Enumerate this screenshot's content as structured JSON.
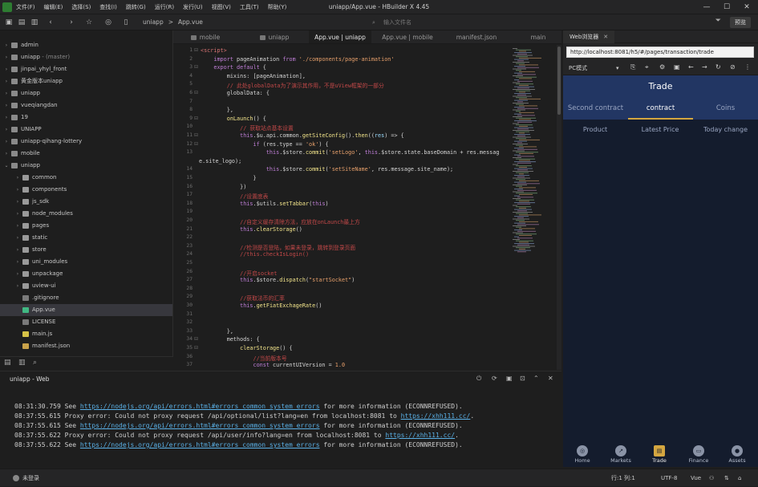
{
  "window": {
    "title": "uniapp/App.vue - HBuilder X 4.45",
    "menu": [
      "文件(F)",
      "编辑(E)",
      "选择(S)",
      "查找(I)",
      "跳转(G)",
      "运行(R)",
      "发行(U)",
      "视图(V)",
      "工具(T)",
      "帮助(Y)"
    ],
    "controls": {
      "minimize": "—",
      "maximize": "☐",
      "close": "✕"
    }
  },
  "toolbar": {
    "breadcrumb": [
      "uniapp",
      ">",
      "App.vue"
    ],
    "file_input_placeholder": "输入文件名",
    "preview_label": "预览"
  },
  "sidebar": {
    "items": [
      {
        "name": "admin",
        "level": 0,
        "type": "project",
        "open": false
      },
      {
        "name": "uniapp",
        "sub": " - (master)",
        "level": 0,
        "type": "project",
        "open": false
      },
      {
        "name": "jinpai_yhyl_front",
        "level": 0,
        "type": "project",
        "open": false
      },
      {
        "name": "黄金版本uniapp",
        "level": 0,
        "type": "project",
        "open": false
      },
      {
        "name": "uniapp",
        "level": 0,
        "type": "project",
        "open": false
      },
      {
        "name": "vueqiangdan",
        "level": 0,
        "type": "project",
        "open": false
      },
      {
        "name": "19",
        "level": 0,
        "type": "project",
        "open": false
      },
      {
        "name": "UNIAPP",
        "level": 0,
        "type": "project",
        "open": false
      },
      {
        "name": "uniapp-qihang-lottery",
        "level": 0,
        "type": "project",
        "open": false
      },
      {
        "name": "mobile",
        "level": 0,
        "type": "project",
        "open": false
      },
      {
        "name": "uniapp",
        "level": 0,
        "type": "project",
        "open": true
      },
      {
        "name": "common",
        "level": 1,
        "type": "folder",
        "open": false
      },
      {
        "name": "components",
        "level": 1,
        "type": "folder",
        "open": false
      },
      {
        "name": "js_sdk",
        "level": 1,
        "type": "folder",
        "open": false
      },
      {
        "name": "node_modules",
        "level": 1,
        "type": "folder",
        "open": false
      },
      {
        "name": "pages",
        "level": 1,
        "type": "folder",
        "open": false
      },
      {
        "name": "static",
        "level": 1,
        "type": "folder",
        "open": false
      },
      {
        "name": "store",
        "level": 1,
        "type": "folder",
        "open": false
      },
      {
        "name": "uni_modules",
        "level": 1,
        "type": "folder",
        "open": false
      },
      {
        "name": "unpackage",
        "level": 1,
        "type": "folder",
        "open": false
      },
      {
        "name": "uview-ui",
        "level": 1,
        "type": "folder",
        "open": false
      },
      {
        "name": ".gitignore",
        "level": 1,
        "type": "file"
      },
      {
        "name": "App.vue",
        "level": 1,
        "type": "vue",
        "selected": true
      },
      {
        "name": "LICENSE",
        "level": 1,
        "type": "file"
      },
      {
        "name": "main.js",
        "level": 1,
        "type": "js"
      },
      {
        "name": "manifest.json",
        "level": 1,
        "type": "json"
      }
    ]
  },
  "editor_tabs": [
    "mobile",
    "uniapp",
    "App.vue | uniapp",
    "App.vue | mobile",
    "manifest.json",
    "main"
  ],
  "code_lines": [
    {
      "n": "1",
      "f": "⊟",
      "segs": [
        [
          "tag",
          "<script>"
        ]
      ]
    },
    {
      "n": "2",
      "f": "",
      "segs": [
        [
          "pn",
          "    "
        ],
        [
          "kw",
          "import"
        ],
        [
          "pn",
          " pageAnimation "
        ],
        [
          "kw",
          "from"
        ],
        [
          "pn",
          " "
        ],
        [
          "str",
          "'./components/page-animation'"
        ]
      ]
    },
    {
      "n": "3",
      "f": "⊟",
      "segs": [
        [
          "pn",
          "    "
        ],
        [
          "kw",
          "export default"
        ],
        [
          "pn",
          " {"
        ]
      ]
    },
    {
      "n": "4",
      "f": "",
      "segs": [
        [
          "pn",
          "        mixins: [pageAnimation],"
        ]
      ]
    },
    {
      "n": "5",
      "f": "",
      "segs": [
        [
          "cm",
          "        // 此处globalData为了演示其作用，不是uView框架的一部分"
        ]
      ]
    },
    {
      "n": "6",
      "f": "⊟",
      "segs": [
        [
          "pn",
          "        globalData: {"
        ]
      ]
    },
    {
      "n": "7",
      "f": "",
      "segs": [
        [
          "pn",
          ""
        ]
      ]
    },
    {
      "n": "8",
      "f": "",
      "segs": [
        [
          "pn",
          "        },"
        ]
      ]
    },
    {
      "n": "9",
      "f": "⊟",
      "segs": [
        [
          "pn",
          "        "
        ],
        [
          "fn",
          "onLaunch"
        ],
        [
          "pn",
          "() {"
        ]
      ]
    },
    {
      "n": "10",
      "f": "",
      "segs": [
        [
          "cm",
          "            // 获取站点基本设置"
        ]
      ]
    },
    {
      "n": "11",
      "f": "⊟",
      "segs": [
        [
          "pn",
          "            "
        ],
        [
          "kw",
          "this"
        ],
        [
          "pn",
          ".$u.api.common."
        ],
        [
          "fn",
          "getSiteConfig"
        ],
        [
          "pn",
          "()."
        ],
        [
          "fn",
          "then"
        ],
        [
          "pn",
          "(("
        ],
        [
          "var",
          "res"
        ],
        [
          "pn",
          ") => {"
        ]
      ]
    },
    {
      "n": "12",
      "f": "⊟",
      "segs": [
        [
          "pn",
          "                "
        ],
        [
          "kw",
          "if"
        ],
        [
          "pn",
          " (res.type == "
        ],
        [
          "str",
          "'ok'"
        ],
        [
          "pn",
          ") {"
        ]
      ]
    },
    {
      "n": "13",
      "f": "",
      "segs": [
        [
          "pn",
          "                    "
        ],
        [
          "kw",
          "this"
        ],
        [
          "pn",
          ".$store."
        ],
        [
          "fn",
          "commit"
        ],
        [
          "pn",
          "("
        ],
        [
          "str",
          "'setLogo'"
        ],
        [
          "pn",
          ", "
        ],
        [
          "kw",
          "this"
        ],
        [
          "pn",
          ".$store.state.baseDomain + res.messag"
        ]
      ]
    },
    {
      "n": "",
      "f": "",
      "segs": [
        [
          "pn",
          "e.site_logo);"
        ]
      ],
      "indent": false
    },
    {
      "n": "14",
      "f": "",
      "segs": [
        [
          "pn",
          "                    "
        ],
        [
          "kw",
          "this"
        ],
        [
          "pn",
          ".$store."
        ],
        [
          "fn",
          "commit"
        ],
        [
          "pn",
          "("
        ],
        [
          "str",
          "'setSiteName'"
        ],
        [
          "pn",
          ", res.message.site_name);"
        ]
      ]
    },
    {
      "n": "15",
      "f": "",
      "segs": [
        [
          "pn",
          "                }"
        ]
      ]
    },
    {
      "n": "16",
      "f": "",
      "segs": [
        [
          "pn",
          "            })"
        ]
      ]
    },
    {
      "n": "17",
      "f": "",
      "segs": [
        [
          "cm",
          "            //设置底表"
        ]
      ]
    },
    {
      "n": "18",
      "f": "",
      "segs": [
        [
          "pn",
          "            "
        ],
        [
          "kw",
          "this"
        ],
        [
          "pn",
          ".$utils."
        ],
        [
          "fn",
          "setTabbar"
        ],
        [
          "pn",
          "("
        ],
        [
          "kw",
          "this"
        ],
        [
          "pn",
          ")"
        ]
      ]
    },
    {
      "n": "19",
      "f": "",
      "segs": [
        [
          "pn",
          ""
        ]
      ]
    },
    {
      "n": "20",
      "f": "",
      "segs": [
        [
          "cm",
          "            //自定义缓存清除方法，应放在onLaunch最上方"
        ]
      ]
    },
    {
      "n": "21",
      "f": "",
      "segs": [
        [
          "pn",
          "            "
        ],
        [
          "kw",
          "this"
        ],
        [
          "pn",
          "."
        ],
        [
          "fn",
          "clearStorage"
        ],
        [
          "pn",
          "()"
        ]
      ]
    },
    {
      "n": "22",
      "f": "",
      "segs": [
        [
          "pn",
          ""
        ]
      ]
    },
    {
      "n": "23",
      "f": "",
      "segs": [
        [
          "cm",
          "            //检测是否登陆，如果未登录，跳转到登录页面"
        ]
      ]
    },
    {
      "n": "24",
      "f": "",
      "segs": [
        [
          "cm",
          "            //this.checkIsLogin()"
        ]
      ]
    },
    {
      "n": "25",
      "f": "",
      "segs": [
        [
          "pn",
          ""
        ]
      ]
    },
    {
      "n": "26",
      "f": "",
      "segs": [
        [
          "cm",
          "            //开启socket"
        ]
      ]
    },
    {
      "n": "27",
      "f": "",
      "segs": [
        [
          "pn",
          "            "
        ],
        [
          "kw",
          "this"
        ],
        [
          "pn",
          ".$store."
        ],
        [
          "fn",
          "dispatch"
        ],
        [
          "pn",
          "("
        ],
        [
          "str",
          "\"startSocket\""
        ],
        [
          "pn",
          ")"
        ]
      ]
    },
    {
      "n": "28",
      "f": "",
      "segs": [
        [
          "pn",
          ""
        ]
      ]
    },
    {
      "n": "29",
      "f": "",
      "segs": [
        [
          "cm",
          "            //获取法币的汇率"
        ]
      ]
    },
    {
      "n": "30",
      "f": "",
      "segs": [
        [
          "pn",
          "            "
        ],
        [
          "kw",
          "this"
        ],
        [
          "pn",
          "."
        ],
        [
          "fn",
          "getFiatExchageRate"
        ],
        [
          "pn",
          "()"
        ]
      ]
    },
    {
      "n": "31",
      "f": "",
      "segs": [
        [
          "pn",
          ""
        ]
      ]
    },
    {
      "n": "32",
      "f": "",
      "segs": [
        [
          "pn",
          ""
        ]
      ]
    },
    {
      "n": "33",
      "f": "",
      "segs": [
        [
          "pn",
          "        },"
        ]
      ]
    },
    {
      "n": "34",
      "f": "⊟",
      "segs": [
        [
          "pn",
          "        methods: {"
        ]
      ]
    },
    {
      "n": "35",
      "f": "⊟",
      "segs": [
        [
          "pn",
          "            "
        ],
        [
          "fn",
          "clearStorage"
        ],
        [
          "pn",
          "() {"
        ]
      ]
    },
    {
      "n": "36",
      "f": "",
      "segs": [
        [
          "cm",
          "                //当前版本号"
        ]
      ]
    },
    {
      "n": "37",
      "f": "",
      "segs": [
        [
          "pn",
          "                "
        ],
        [
          "kw",
          "const"
        ],
        [
          "pn",
          " currentUIVersion = "
        ],
        [
          "str",
          "1.0"
        ]
      ]
    }
  ],
  "terminal": {
    "tab": "uniapp - Web",
    "lines": [
      [
        [
          "t",
          "08:31:30.759 See "
        ],
        [
          "l",
          "https://nodejs.org/api/errors.html#errors_common_system_errors"
        ],
        [
          "t",
          " for more information (ECONNREFUSED)."
        ]
      ],
      [
        [
          "t",
          "08:37:55.615 Proxy error: Could not proxy request /api/optional/list?lang=en from localhost:8081 to "
        ],
        [
          "l",
          "https://xhh111.cc/"
        ],
        [
          "t",
          "."
        ]
      ],
      [
        [
          "t",
          "08:37:55.615 See "
        ],
        [
          "l",
          "https://nodejs.org/api/errors.html#errors_common_system_errors"
        ],
        [
          "t",
          " for more information (ECONNREFUSED)."
        ]
      ],
      [
        [
          "t",
          "08:37:55.622 Proxy error: Could not proxy request /api/user/info?lang=en from localhost:8081 to "
        ],
        [
          "l",
          "https://xhh111.cc/"
        ],
        [
          "t",
          "."
        ]
      ],
      [
        [
          "t",
          "08:37:55.622 See "
        ],
        [
          "l",
          "https://nodejs.org/api/errors.html#errors_common_system_errors"
        ],
        [
          "t",
          " for more information (ECONNREFUSED)."
        ]
      ]
    ]
  },
  "preview": {
    "tab": "Web浏览器",
    "url": "http://localhost:8081/h5/#/pages/transaction/trade",
    "mode": "PC模式",
    "app": {
      "title": "Trade",
      "tabs": [
        "Second contract",
        "contract",
        "Coins"
      ],
      "active_tab": 1,
      "columns": [
        "Product",
        "Latest Price",
        "Today change"
      ],
      "nav": [
        "Home",
        "Markets",
        "Trade",
        "Finance",
        "Assets"
      ],
      "active_nav": 2,
      "colors": {
        "header": "#223663",
        "background": "#141c2d",
        "accent": "#d4a640"
      }
    }
  },
  "statusbar": {
    "login": "未登录",
    "position": "行:1  列:1",
    "encoding": "UTF-8",
    "language": "Vue"
  }
}
